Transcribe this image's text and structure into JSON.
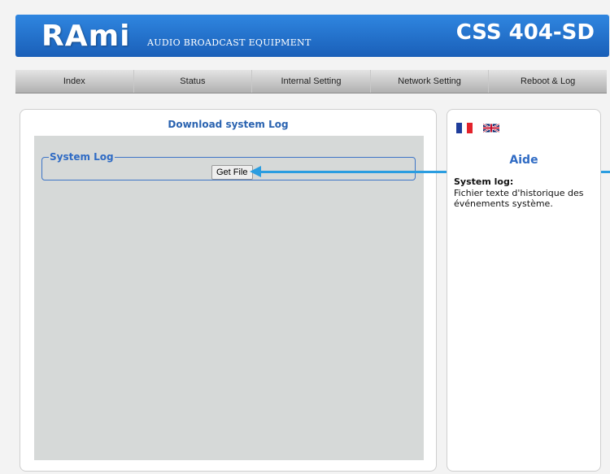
{
  "header": {
    "logo": "RAmi",
    "logo_subtitle": "AUDIO BROADCAST EQUIPMENT",
    "model": "CSS 404-SD",
    "color": "#1f6fcc"
  },
  "nav": {
    "items": [
      {
        "label": "Index"
      },
      {
        "label": "Status"
      },
      {
        "label": "Internal Setting"
      },
      {
        "label": "Network Setting"
      },
      {
        "label": "Reboot & Log"
      }
    ]
  },
  "main": {
    "title": "Download system Log",
    "fieldset_legend": "System Log",
    "button_label": "Get File"
  },
  "help": {
    "title": "Aide",
    "heading": "System log:",
    "text": "Fichier texte d'historique des événements système.",
    "flags": [
      "fr-flag-icon",
      "uk-flag-icon"
    ]
  },
  "annotation": {
    "arrow_color": "#2a9de0"
  }
}
